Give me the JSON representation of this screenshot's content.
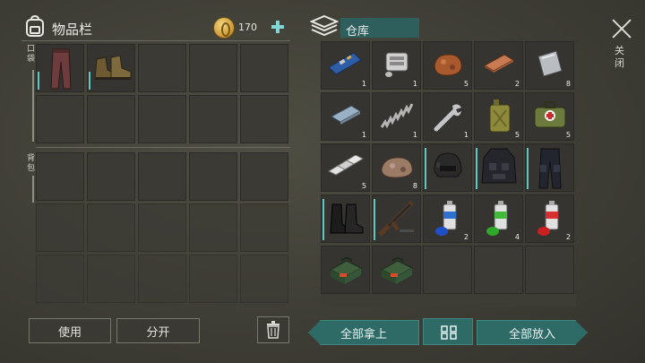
{
  "inventory": {
    "title": "物品栏",
    "coins": "170",
    "sections": {
      "pocket": "口袋",
      "backpack": "背包"
    },
    "pocket_slots": [
      {
        "name": "trousers",
        "qty": ""
      },
      {
        "name": "boots",
        "qty": ""
      },
      {
        "name": "empty",
        "qty": ""
      },
      {
        "name": "empty",
        "qty": ""
      },
      {
        "name": "empty",
        "qty": ""
      },
      {
        "name": "empty",
        "qty": ""
      },
      {
        "name": "empty",
        "qty": ""
      },
      {
        "name": "empty",
        "qty": ""
      },
      {
        "name": "empty",
        "qty": ""
      },
      {
        "name": "empty",
        "qty": ""
      }
    ]
  },
  "storage": {
    "title": "仓库",
    "items": [
      {
        "name": "circuit-board",
        "qty": "1"
      },
      {
        "name": "engine-part",
        "qty": "1"
      },
      {
        "name": "copper-ore",
        "qty": "5"
      },
      {
        "name": "copper-ingot",
        "qty": "2"
      },
      {
        "name": "metal-plate",
        "qty": "8"
      },
      {
        "name": "steel-ingot",
        "qty": "1"
      },
      {
        "name": "spring",
        "qty": "1"
      },
      {
        "name": "wrench",
        "qty": "1"
      },
      {
        "name": "jerry-can",
        "qty": "5"
      },
      {
        "name": "first-aid-bag",
        "qty": "5"
      },
      {
        "name": "aluminum-bars",
        "qty": "5"
      },
      {
        "name": "iron-ore",
        "qty": "8"
      },
      {
        "name": "combat-helmet",
        "qty": ""
      },
      {
        "name": "tactical-vest",
        "qty": ""
      },
      {
        "name": "tactical-pants",
        "qty": ""
      },
      {
        "name": "combat-boots",
        "qty": ""
      },
      {
        "name": "assault-rifle",
        "qty": ""
      },
      {
        "name": "spray-can-blue",
        "qty": "2"
      },
      {
        "name": "spray-can-green",
        "qty": "4"
      },
      {
        "name": "spray-can-red",
        "qty": "2"
      },
      {
        "name": "ammo-crate",
        "qty": ""
      },
      {
        "name": "ammo-crate",
        "qty": ""
      },
      {
        "name": "empty",
        "qty": ""
      },
      {
        "name": "empty",
        "qty": ""
      },
      {
        "name": "empty",
        "qty": ""
      }
    ]
  },
  "close_label": "关闭",
  "buttons": {
    "use": "使用",
    "split": "分开",
    "take_all": "全部拿上",
    "put_all": "全部放入"
  },
  "colors": {
    "accent": "#2f6b66",
    "accent_light": "#7fd6d2",
    "background": "#45443c"
  },
  "icons": [
    "backpack-icon",
    "coin-icon",
    "plus-icon",
    "storage-icon",
    "close-icon",
    "trash-icon",
    "grid-sort-icon"
  ]
}
